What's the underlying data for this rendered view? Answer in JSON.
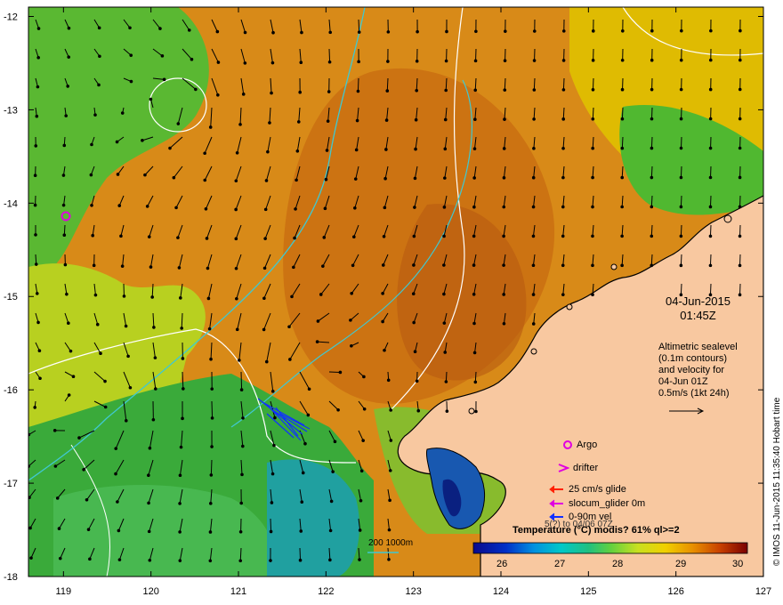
{
  "map": {
    "x_ticks": [
      "119",
      "120",
      "121",
      "122",
      "123",
      "124",
      "125",
      "126",
      "127"
    ],
    "y_ticks": [
      "-12",
      "-13",
      "-14",
      "-15",
      "-16",
      "-17",
      "-18"
    ],
    "lon_range": [
      118.6,
      127
    ],
    "lat_range": [
      -18,
      -11.9
    ]
  },
  "info": {
    "date": "04-Jun-2015",
    "time": "01:45Z",
    "alt_lines": [
      "Altimetric sealevel",
      "(0.1m contours)",
      "and velocity for",
      "04-Jun 01Z",
      "0.5m/s (1kt 24h)"
    ]
  },
  "legend": {
    "argo": "Argo",
    "drifter": "drifter",
    "glide": "25 cm/s glide",
    "slocum": "slocum_glider 0m",
    "vel": "0-90m vel",
    "partial": "5(?) to 04/06 07Z",
    "colors": {
      "argo": "#e000e0",
      "drifter": "#e000e0",
      "glide": "#ff2000",
      "slocum": "#e000e0",
      "vel": "#1030ff"
    }
  },
  "colorbar": {
    "title": "Temperature (°C) modis? 61% ql>=2",
    "ticks": [
      "26",
      "27",
      "28",
      "29",
      "30"
    ],
    "range": [
      25.6,
      30.4
    ]
  },
  "scale": {
    "label": "200  1000m"
  },
  "credit": "© IMOS 11-Jun-2015 11:35:40 Hobart time"
}
